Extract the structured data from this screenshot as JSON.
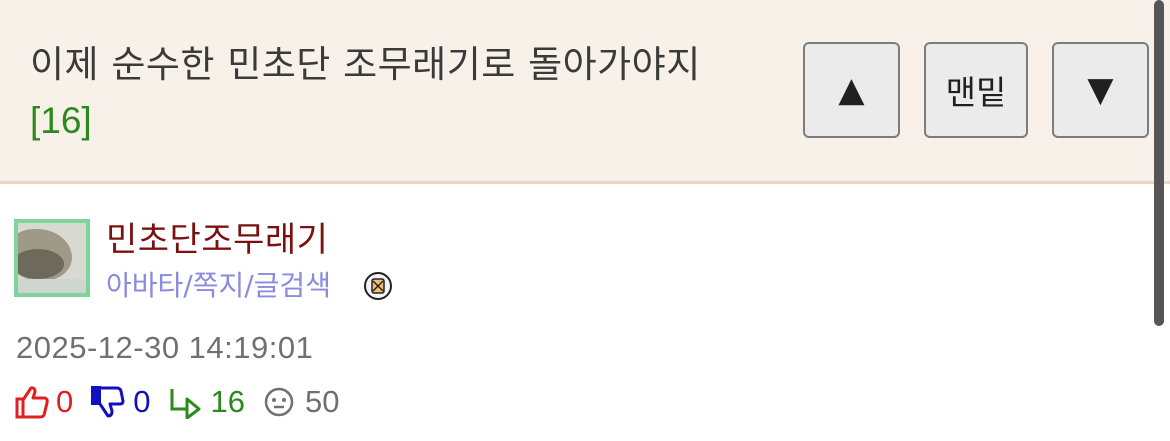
{
  "post": {
    "title": "이제 순수한 민초단 조무래기로 돌아가야지",
    "reply_count": "[16]"
  },
  "nav": {
    "up_label": "▲",
    "bottom_label": "맨밑",
    "down_label": "▼"
  },
  "author": {
    "name": "민초단조무래기",
    "links": "아바타/쪽지/글검색"
  },
  "meta": {
    "timestamp": "2025-12-30 14:19:01",
    "likes": "0",
    "dislikes": "0",
    "replies": "16",
    "views": "50"
  },
  "colors": {
    "header_bg": "#f8f1ea",
    "title_text": "#3a3a3a",
    "count_green": "#2a8a1a",
    "username": "#7a1010",
    "links": "#8a8ae0",
    "like_red": "#e02020",
    "dislike_blue": "#1010c0"
  },
  "icons": [
    "up-arrow-icon",
    "down-arrow-icon",
    "avatar",
    "member-badge-icon",
    "thumbs-up-icon",
    "thumbs-down-icon",
    "reply-arrow-icon",
    "view-face-icon"
  ]
}
